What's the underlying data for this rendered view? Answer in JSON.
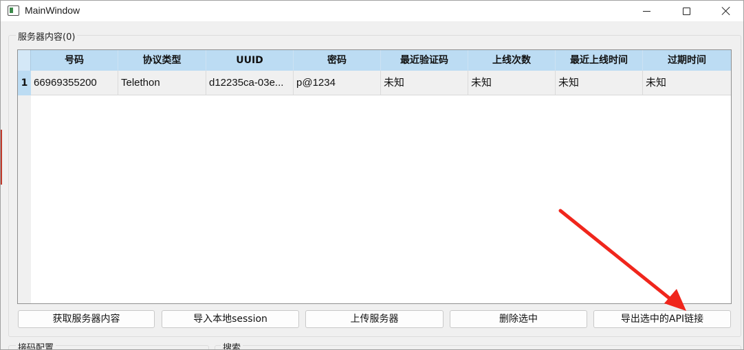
{
  "window": {
    "title": "MainWindow"
  },
  "server_group": {
    "title": "服务器内容(0)"
  },
  "table": {
    "columns": [
      "号码",
      "协议类型",
      "UUID",
      "密码",
      "最近验证码",
      "上线次数",
      "最近上线时间",
      "过期时间"
    ],
    "rows": [
      {
        "index": "1",
        "cells": [
          "66969355200",
          "Telethon",
          "d12235ca-03e...",
          "p@1234",
          "未知",
          "未知",
          "未知",
          "未知"
        ]
      }
    ]
  },
  "buttons": {
    "fetch": "获取服务器内容",
    "import": "导入本地session",
    "upload": "上传服务器",
    "delete": "删除选中",
    "export": "导出选中的API链接"
  },
  "bottom_groups": {
    "code_config": "接码配置",
    "search": "搜索"
  },
  "colors": {
    "header_bg": "#bcdcf3",
    "annotation_arrow": "#f0261c"
  }
}
